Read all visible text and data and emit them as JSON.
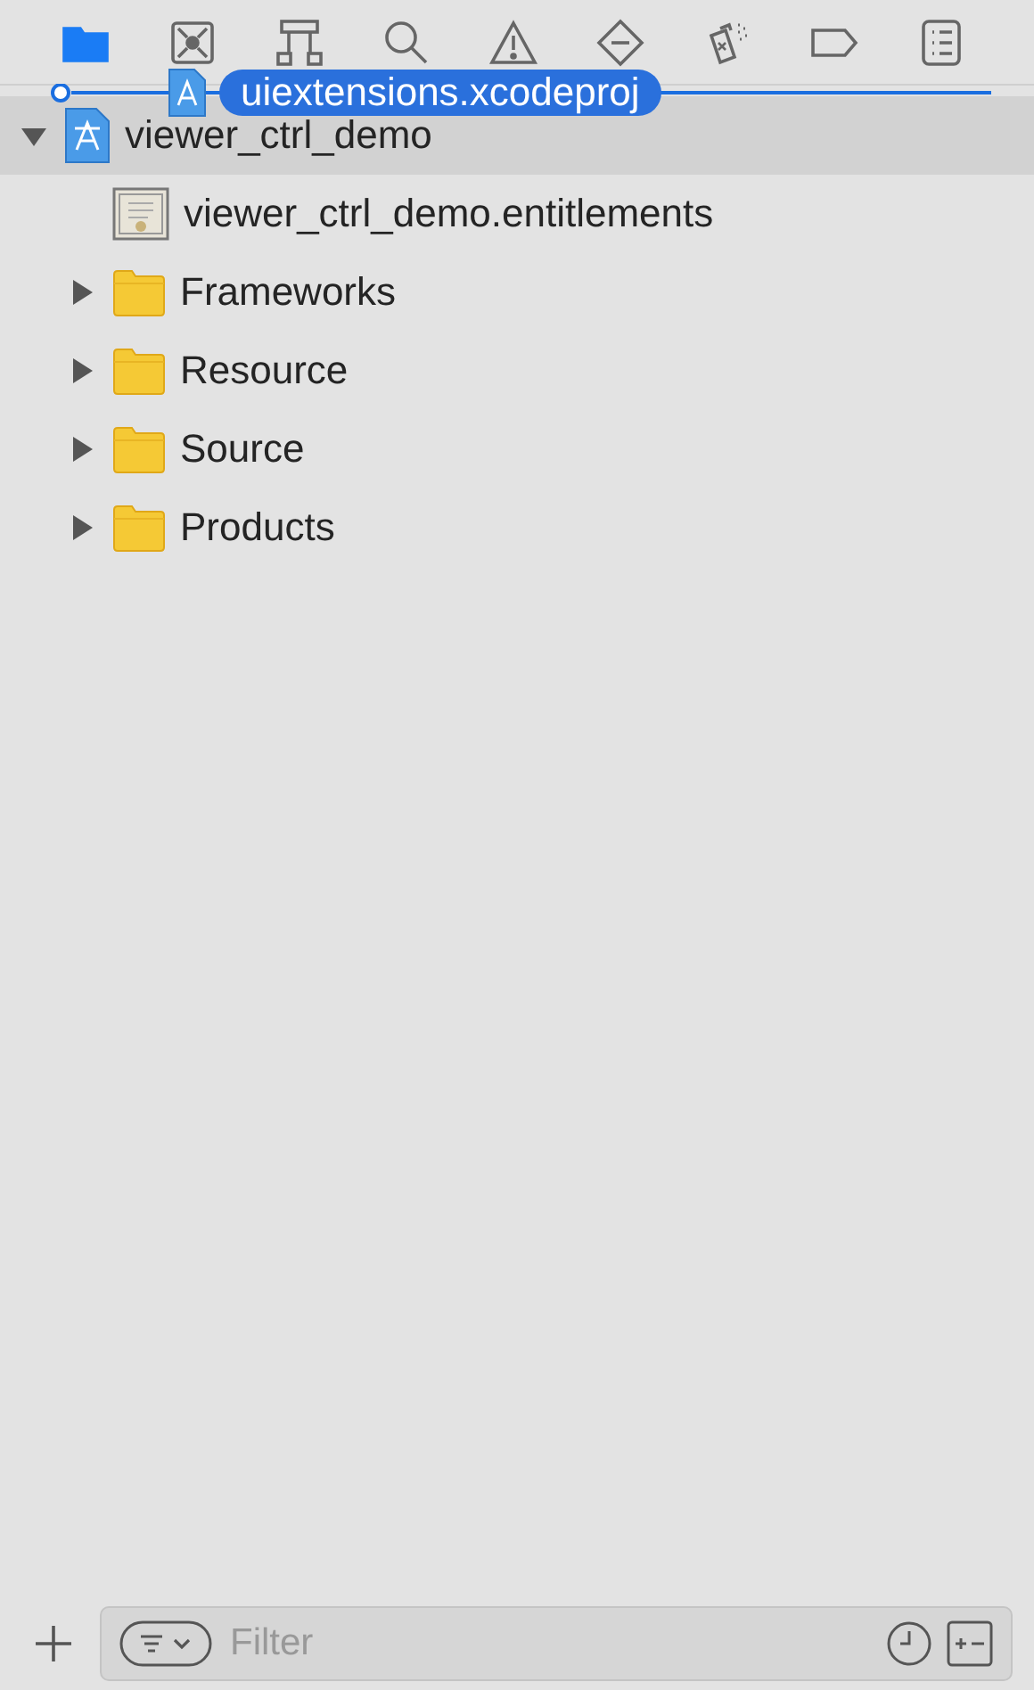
{
  "navigator_tabs": [
    {
      "kind": "project",
      "selected": true
    },
    {
      "kind": "source-control",
      "selected": false
    },
    {
      "kind": "hierarchy",
      "selected": false
    },
    {
      "kind": "find",
      "selected": false
    },
    {
      "kind": "issue",
      "selected": false
    },
    {
      "kind": "test",
      "selected": false
    },
    {
      "kind": "debug",
      "selected": false
    },
    {
      "kind": "breakpoint",
      "selected": false
    },
    {
      "kind": "report",
      "selected": false
    }
  ],
  "tree": [
    {
      "name": "viewer_ctrl_demo",
      "kind": "project",
      "expanded": true,
      "selected": true,
      "children": [
        {
          "name": "viewer_ctrl_demo.entitlements",
          "kind": "entitlements",
          "selected": false
        },
        {
          "name": "Frameworks",
          "kind": "folder",
          "expanded": false,
          "selected": false
        },
        {
          "name": "Resource",
          "kind": "folder",
          "expanded": false,
          "selected": false
        },
        {
          "name": "Source",
          "kind": "folder",
          "expanded": false,
          "selected": false
        },
        {
          "name": "Products",
          "kind": "folder",
          "expanded": false,
          "selected": false
        }
      ]
    }
  ],
  "drag": {
    "label": "uiextensions.xcodeproj"
  },
  "filter": {
    "placeholder": "Filter"
  }
}
